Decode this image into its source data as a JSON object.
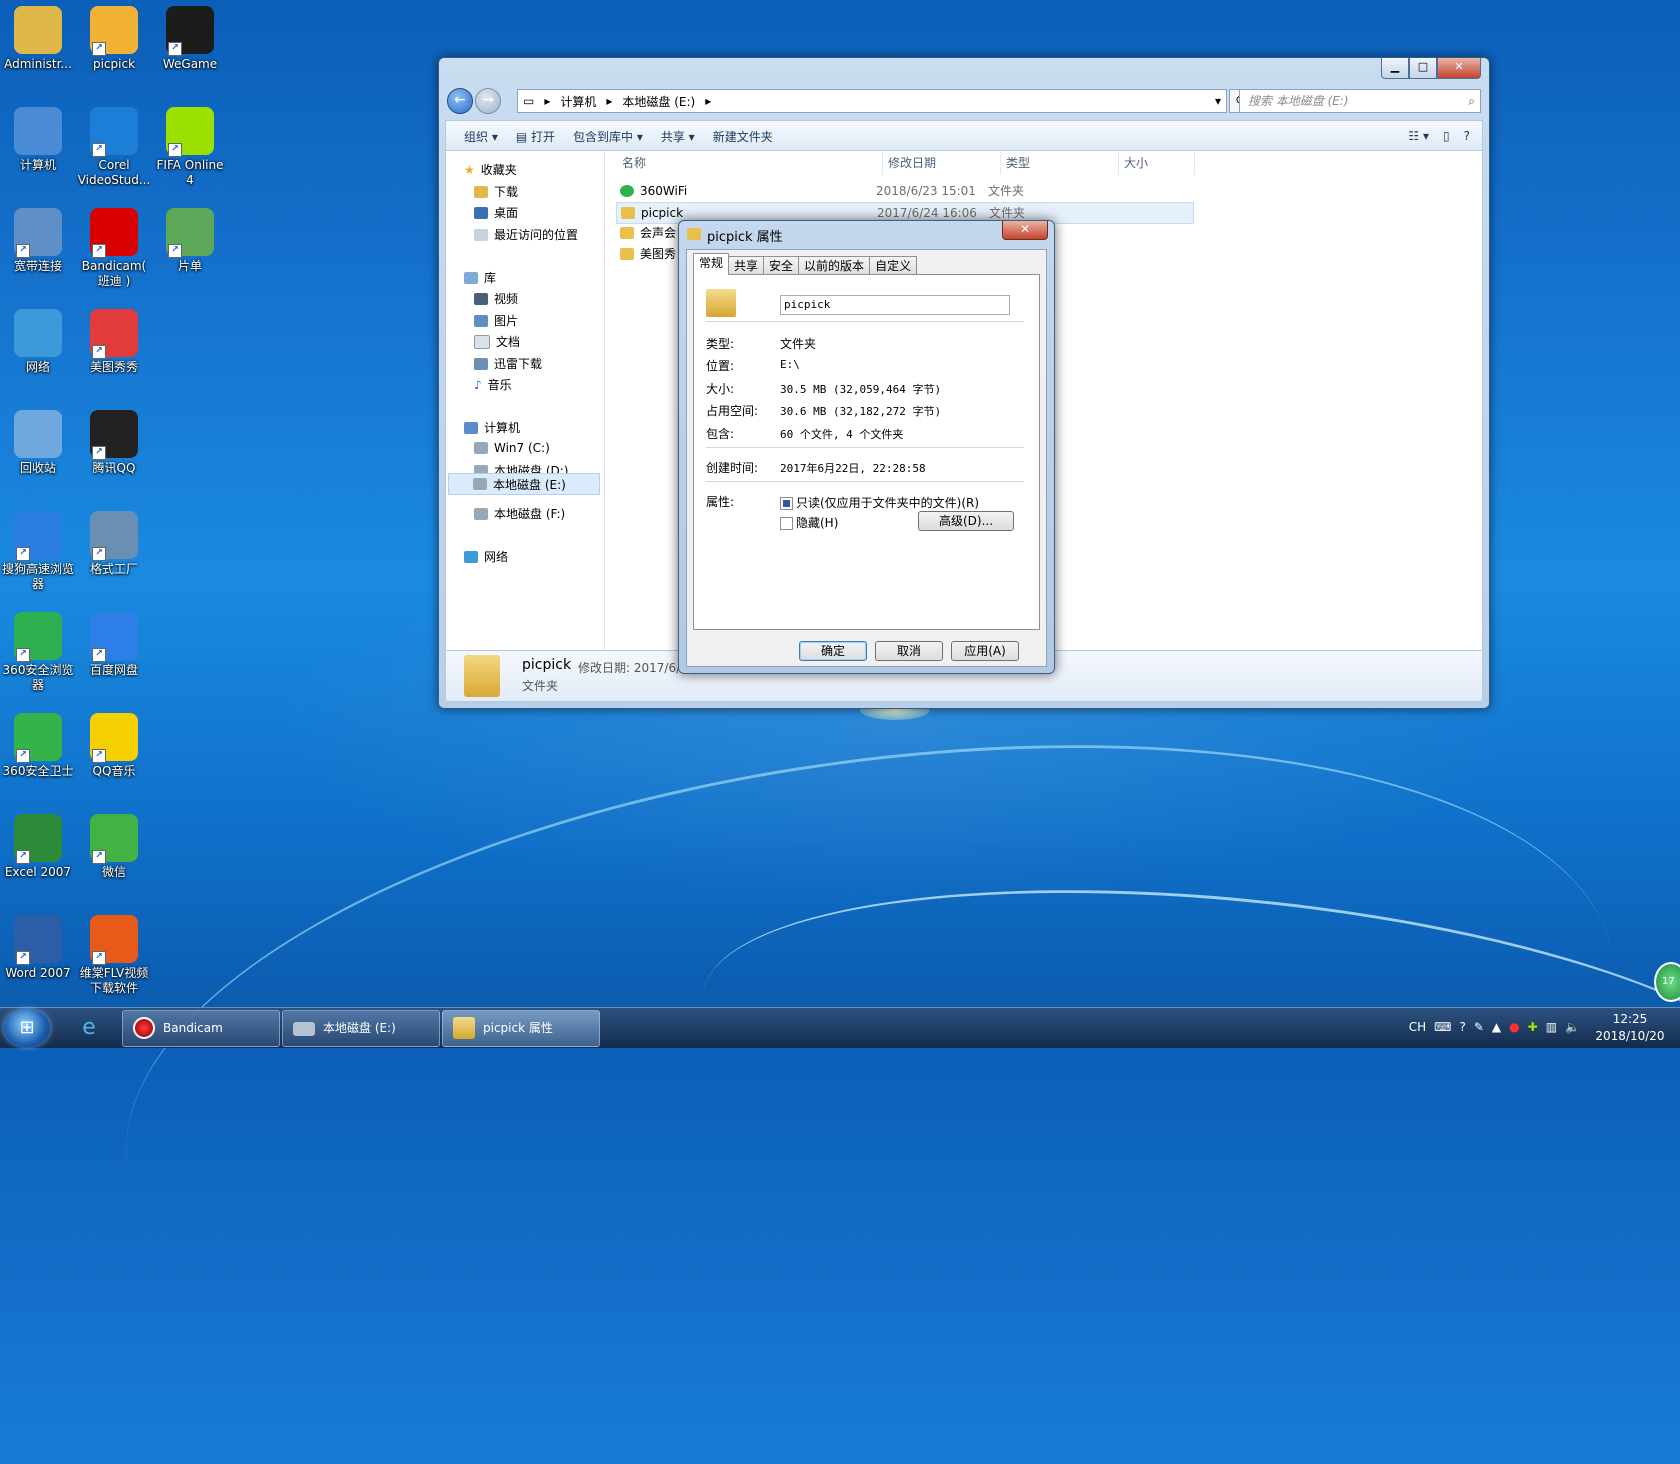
{
  "desktop": {
    "icons": [
      {
        "label": "Administr...",
        "icon": "user-folder-icon",
        "color": "#e0b84a"
      },
      {
        "label": "picpick",
        "icon": "picpick-icon",
        "color": "#f2b233"
      },
      {
        "label": "WeGame",
        "icon": "wegame-icon",
        "color": "#1c1c1c"
      },
      {
        "label": "计算机",
        "icon": "computer-icon",
        "color": "#4a8bd6"
      },
      {
        "label": "Corel VideoStud...",
        "icon": "corel-videostudio-icon",
        "color": "#1d7ed8"
      },
      {
        "label": "FIFA Online 4",
        "icon": "fifa-online-icon",
        "color": "#9be000"
      },
      {
        "label": "宽带连接",
        "icon": "broadband-connection-icon",
        "color": "#5f8fc7"
      },
      {
        "label": "Bandicam( 班迪 )",
        "icon": "bandicam-icon",
        "color": "#d80000"
      },
      {
        "label": "片单",
        "icon": "spreadsheet-file-icon",
        "color": "#5ea85a"
      },
      {
        "label": "网络",
        "icon": "network-icon",
        "color": "#3c9ad8"
      },
      {
        "label": "美图秀秀",
        "icon": "meitu-xiuxiu-icon",
        "color": "#e23b3b"
      },
      {
        "label": "回收站",
        "icon": "recycle-bin-icon",
        "color": "#6fa8dc"
      },
      {
        "label": "腾讯QQ",
        "icon": "qq-penguin-icon",
        "color": "#222222"
      },
      {
        "label": "搜狗高速浏览器",
        "icon": "sogou-browser-icon",
        "color": "#2a7de1"
      },
      {
        "label": "格式工厂",
        "icon": "format-factory-icon",
        "color": "#6b8fb2"
      },
      {
        "label": "360安全浏览器",
        "icon": "360-browser-icon",
        "color": "#2fb050"
      },
      {
        "label": "百度网盘",
        "icon": "baidu-netdisk-icon",
        "color": "#2e7ee8"
      },
      {
        "label": "360安全卫士",
        "icon": "360-security-icon",
        "color": "#34b34a"
      },
      {
        "label": "QQ音乐",
        "icon": "qq-music-icon",
        "color": "#f5d000"
      },
      {
        "label": "Excel 2007",
        "icon": "excel-icon",
        "color": "#2d8a3a"
      },
      {
        "label": "微信",
        "icon": "wechat-icon",
        "color": "#43b244"
      },
      {
        "label": "Word 2007",
        "icon": "word-icon",
        "color": "#2b5ea7"
      },
      {
        "label": "维棠FLV视频下载软件",
        "icon": "flv-downloader-icon",
        "color": "#e85a1a"
      }
    ]
  },
  "explorer": {
    "breadcrumb": [
      "计算机",
      "本地磁盘 (E:)"
    ],
    "search_placeholder": "搜索 本地磁盘 (E:)",
    "toolbar": {
      "organize": "组织 ▾",
      "open": "打开",
      "include": "包含到库中 ▾",
      "share": "共享 ▾",
      "new_folder": "新建文件夹"
    },
    "nav": {
      "favorites": "收藏夹",
      "downloads": "下载",
      "desktop": "桌面",
      "recent": "最近访问的位置",
      "libraries": "库",
      "videos": "视频",
      "pictures": "图片",
      "documents": "文档",
      "thunder": "迅雷下载",
      "music": "音乐",
      "computer": "计算机",
      "drive_c": "Win7 (C:)",
      "drive_d": "本地磁盘 (D:)",
      "drive_e": "本地磁盘 (E:)",
      "drive_f": "本地磁盘 (F:)",
      "network": "网络"
    },
    "columns": {
      "name": "名称",
      "date": "修改日期",
      "type": "类型",
      "size": "大小"
    },
    "files": [
      {
        "name": "360WiFi",
        "date": "2018/6/23 15:01",
        "type": "文件夹"
      },
      {
        "name": "picpick",
        "date": "2017/6/24 16:06",
        "type": "文件夹"
      },
      {
        "name": "会声会",
        "date": "",
        "type": ""
      },
      {
        "name": "美图秀",
        "date": "",
        "type": ""
      }
    ],
    "details": {
      "name": "picpick",
      "meta": "修改日期: 2017/6/2",
      "type": "文件夹"
    }
  },
  "dialog": {
    "title": "picpick 属性",
    "tabs": [
      "常规",
      "共享",
      "安全",
      "以前的版本",
      "自定义"
    ],
    "folder_name": "picpick",
    "type_label": "类型:",
    "type_value": "文件夹",
    "location_label": "位置:",
    "location_value": "E:\\",
    "size_label": "大小:",
    "size_value": "30.5 MB (32,059,464 字节)",
    "disk_label": "占用空间:",
    "disk_value": "30.6 MB (32,182,272 字节)",
    "contains_label": "包含:",
    "contains_value": "60 个文件, 4 个文件夹",
    "created_label": "创建时间:",
    "created_value": "2017年6月22日, 22:28:58",
    "attrs_label": "属性:",
    "readonly_label": "只读(仅应用于文件夹中的文件)(R)",
    "hidden_label": "隐藏(H)",
    "advanced_btn": "高级(D)...",
    "ok": "确定",
    "cancel": "取消",
    "apply": "应用(A)"
  },
  "taskbar": {
    "tasks": [
      "Bandicam",
      "本地磁盘 (E:)",
      "picpick 属性"
    ],
    "tray_lang": "CH",
    "time": "12:25",
    "date": "2018/10/20"
  }
}
